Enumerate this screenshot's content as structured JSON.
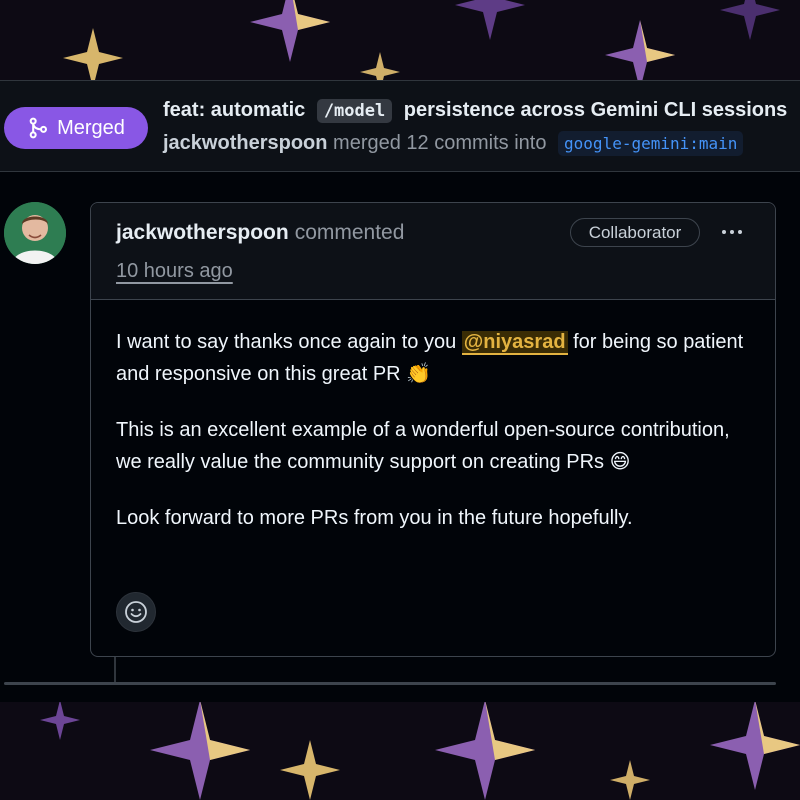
{
  "theme": {
    "accent_merged": "#8957e5",
    "mention_color": "#e3b341",
    "link_color": "#4493f8",
    "background": "#0d0a14"
  },
  "pull_request": {
    "state_label": "Merged",
    "state_icon": "git-merge-icon",
    "title_prefix": "feat: automatic",
    "title_code": "/model",
    "title_suffix": "persistence across Gemini CLI sessions",
    "author": "jackwotherspoon",
    "merge_text": "merged 12 commits into",
    "target_branch": "google-gemini:main"
  },
  "comment": {
    "avatar_icon": "user-avatar",
    "author": "jackwotherspoon",
    "action": "commented",
    "time": "10 hours ago",
    "role_badge": "Collaborator",
    "menu_icon": "kebab-horizontal-icon",
    "para1_before": "I want to say thanks once again to you ",
    "mention": "@niyasrad",
    "para1_after": " for being so patient and responsive on this great PR 👏",
    "para2": "This is an excellent example of a wonderful open-source contribution, we really value the community support on creating PRs 😄",
    "para3": "Look forward to more PRs from you in the future hopefully.",
    "reaction_icon": "smiley-icon"
  }
}
